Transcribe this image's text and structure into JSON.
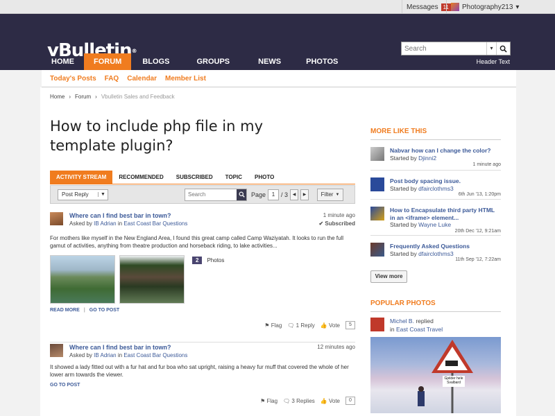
{
  "topbar": {
    "messages_label": "Messages",
    "messages_count": "11",
    "username": "Photography213"
  },
  "header": {
    "logo": "vBulletin",
    "search_placeholder": "Search",
    "header_text": "Header Text"
  },
  "nav": [
    {
      "label": "HOME"
    },
    {
      "label": "FORUM"
    },
    {
      "label": "BLOGS"
    },
    {
      "label": "GROUPS"
    },
    {
      "label": "NEWS"
    },
    {
      "label": "PHOTOS"
    }
  ],
  "subnav": [
    {
      "label": "Today's Posts"
    },
    {
      "label": "FAQ"
    },
    {
      "label": "Calendar"
    },
    {
      "label": "Member List"
    }
  ],
  "breadcrumb": {
    "home": "Home",
    "forum": "Forum",
    "current": "Vbulletin Sales and Feedback"
  },
  "page_title": "How to include php file in my template plugin?",
  "tabs": [
    {
      "label": "ACTIVITY STREAM"
    },
    {
      "label": "RECOMMENDED"
    },
    {
      "label": "SUBSCRIBED"
    },
    {
      "label": "TOPIC"
    },
    {
      "label": "PHOTO"
    }
  ],
  "toolbar": {
    "post_reply": "Post Reply",
    "search_placeholder": "Search",
    "page_label": "Page",
    "page_value": "1",
    "page_total": "/ 3",
    "filter": "Filter"
  },
  "posts": [
    {
      "title": "Where can I find best bar in town?",
      "asked_by_prefix": "Asked by",
      "author": "IB Adrian",
      "in_prefix": "in",
      "forum": "East Coast Bar Questions",
      "time": "1 minute ago",
      "subscribed": "Subscribed",
      "body": "For mothers like myself in the New England Area, I found this great camp called Camp Waziyatah. It looks to run the full gamut of activities, anything from theatre production and horseback riding, to lake activities...",
      "photo_count": "2",
      "photo_label": "Photos",
      "read_more": "READ MORE",
      "go_to_post": "GO TO POST",
      "flag": "Flag",
      "replies": "1 Reply",
      "vote": "Vote",
      "vote_count": "5"
    },
    {
      "title": "Where can I find best bar in town?",
      "asked_by_prefix": "Asked by",
      "author": "IB Adrian",
      "in_prefix": "in",
      "forum": "East Coast Bar Questions",
      "time": "12 minutes ago",
      "body": "It showed a lady fitted out with a fur hat and fur boa who sat upright, raising a heavy fur muff that covered the whole of her lower arm towards the viewer.",
      "go_to_post": "GO TO POST",
      "flag": "Flag",
      "replies": "3 Replies",
      "vote": "Vote",
      "vote_count": "0"
    }
  ],
  "sidebar": {
    "more_like_this": "MORE LIKE THIS",
    "items": [
      {
        "title": "Nabvar how can I change the color?",
        "started_by": "Started by",
        "author": "Djinni2",
        "date": "1 minute ago"
      },
      {
        "title": "Post body spacing issue.",
        "started_by": "Started by",
        "author": "dfairclothms3",
        "date": "6th Jun '13, 1:20pm"
      },
      {
        "title": "How to Encapsulate third party HTML in an <iframe> element...",
        "started_by": "Started by",
        "author": "Wayne Luke",
        "date": "20th Dec '12, 9:21am"
      },
      {
        "title": "Frequently Asked Questions",
        "started_by": "Started by",
        "author": "dfairclothms3",
        "date": "11th Sep '12, 7:22am"
      }
    ],
    "view_more": "View more",
    "popular_photos": "POPULAR PHOTOS",
    "photo_author": "Michel B.",
    "photo_action": "replied",
    "photo_in": "in",
    "photo_forum": "East Coast Travel",
    "sign_text_1": "Gjelder hele",
    "sign_text_2": "Svalbard"
  },
  "colors": {
    "accent": "#f07c1f",
    "header_bg": "#2d2b45",
    "link": "#3b5998"
  }
}
